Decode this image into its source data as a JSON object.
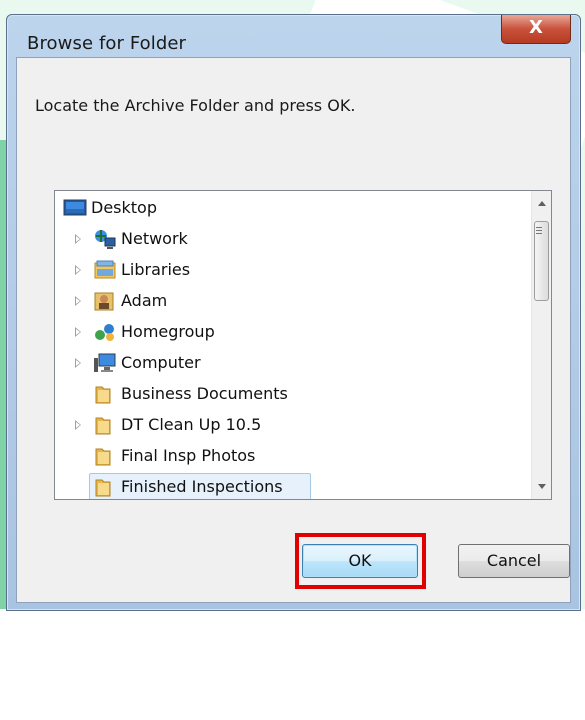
{
  "dialog": {
    "title": "Browse for Folder",
    "close_glyph": "X",
    "instruction": "Locate the Archive Folder and press OK."
  },
  "tree": {
    "items": [
      {
        "label": "Desktop",
        "icon": "desktop-icon",
        "has_expander": false
      },
      {
        "label": "Network",
        "icon": "network-icon",
        "has_expander": true
      },
      {
        "label": "Libraries",
        "icon": "libraries-icon",
        "has_expander": true
      },
      {
        "label": "Adam",
        "icon": "user-folder-icon",
        "has_expander": true
      },
      {
        "label": "Homegroup",
        "icon": "homegroup-icon",
        "has_expander": true
      },
      {
        "label": "Computer",
        "icon": "computer-icon",
        "has_expander": true
      },
      {
        "label": "Business Documents",
        "icon": "folder-icon",
        "has_expander": false
      },
      {
        "label": "DT Clean Up 10.5",
        "icon": "folder-icon",
        "has_expander": true
      },
      {
        "label": "Final Insp Photos",
        "icon": "folder-icon",
        "has_expander": false
      },
      {
        "label": "Finished Inspections",
        "icon": "folder-icon",
        "has_expander": false,
        "selected": true
      }
    ]
  },
  "buttons": {
    "ok_label": "OK",
    "cancel_label": "Cancel"
  },
  "colors": {
    "highlight": "#e00000",
    "selection": "#e6f1fb",
    "close_button": "#c9513b"
  }
}
